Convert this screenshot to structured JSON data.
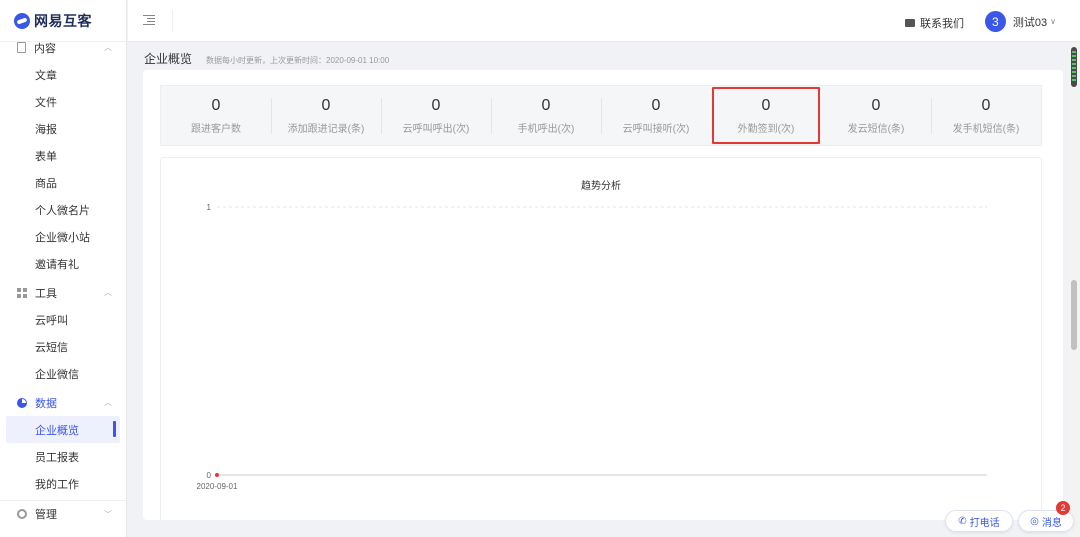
{
  "app": {
    "logo_text": "网易互客"
  },
  "sidebar": {
    "groups": [
      {
        "label": "内容",
        "icon": "document-icon",
        "items": [
          "文章",
          "文件",
          "海报",
          "表单",
          "商品",
          "个人微名片",
          "企业微小站",
          "邀请有礼"
        ]
      },
      {
        "label": "工具",
        "icon": "grid-icon",
        "items": [
          "云呼叫",
          "云短信",
          "企业微信"
        ]
      },
      {
        "label": "数据",
        "icon": "pie-chart-icon",
        "items": [
          "企业概览",
          "员工报表",
          "我的工作"
        ]
      },
      {
        "label": "管理",
        "icon": "gear-icon",
        "items": []
      }
    ],
    "active_item": "企业概览"
  },
  "header": {
    "contact_label": "联系我们",
    "user_avatar_number": "3",
    "user_name": "测试03"
  },
  "page": {
    "title": "企业概览",
    "update_note": "数据每小时更新，上次更新时间：2020-09-01 10:00"
  },
  "stats": [
    {
      "value": "0",
      "label": "跟进客户数"
    },
    {
      "value": "0",
      "label": "添加跟进记录(条)"
    },
    {
      "value": "0",
      "label": "云呼叫呼出(次)"
    },
    {
      "value": "0",
      "label": "手机呼出(次)"
    },
    {
      "value": "0",
      "label": "云呼叫接听(次)"
    },
    {
      "value": "0",
      "label": "外勤签到(次)",
      "highlighted": true
    },
    {
      "value": "0",
      "label": "发云短信(条)"
    },
    {
      "value": "0",
      "label": "发手机短信(条)"
    }
  ],
  "chart_data": {
    "type": "line",
    "title": "趋势分析",
    "x": [
      "2020-09-01"
    ],
    "series": [
      {
        "values": [
          0
        ]
      }
    ],
    "yticks": [
      "0",
      "1"
    ],
    "ylim": [
      0,
      1
    ],
    "grid": true,
    "point_color": "#e53935"
  },
  "floating": {
    "call_label": "打电话",
    "message_label": "消息",
    "message_badge": "2"
  },
  "colors": {
    "brand": "#3a57e8",
    "highlight_border": "#e53935"
  }
}
